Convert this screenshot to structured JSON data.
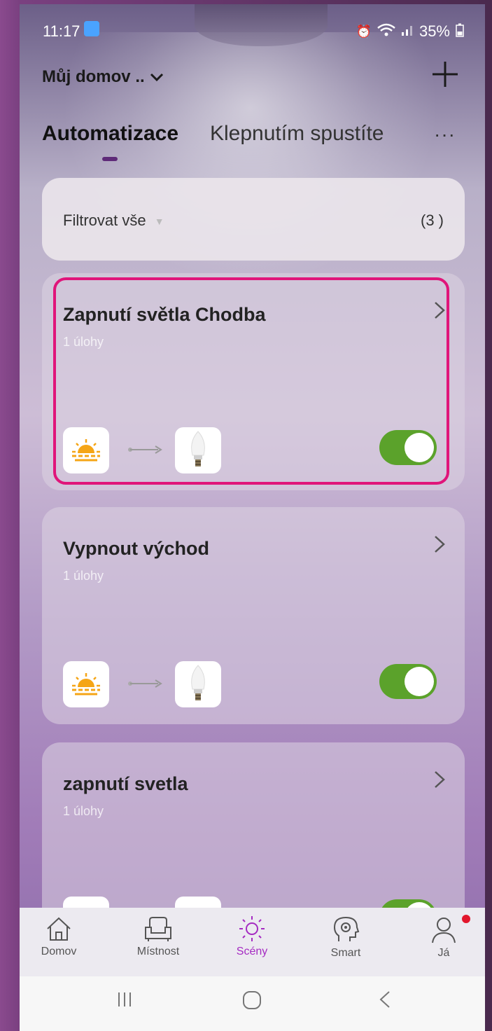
{
  "status_bar": {
    "time": "11:17",
    "battery": "35%"
  },
  "header": {
    "home_name": "Můj domov ..",
    "tabs": [
      {
        "label": "Automatizace",
        "active": true
      },
      {
        "label": "Klepnutím spustíte",
        "active": false
      }
    ],
    "more_label": "···"
  },
  "filter": {
    "label": "Filtrovat vše",
    "count": "(3 )"
  },
  "automations": [
    {
      "title": "Zapnutí světla Chodba",
      "subtitle": "1 úlohy",
      "enabled": true,
      "trigger_icon": "sunrise-icon",
      "action_icon": "bulb-icon"
    },
    {
      "title": "Vypnout východ",
      "subtitle": "1 úlohy",
      "enabled": true,
      "trigger_icon": "sunrise-icon",
      "action_icon": "bulb-icon"
    },
    {
      "title": "zapnutí svetla",
      "subtitle": "1 úlohy",
      "enabled": true,
      "trigger_icon": "sunrise-icon",
      "action_icon": "bulb-icon"
    }
  ],
  "tabbar": {
    "items": [
      {
        "label": "Domov",
        "icon": "home-icon"
      },
      {
        "label": "Místnost",
        "icon": "armchair-icon"
      },
      {
        "label": "Scény",
        "icon": "sun-icon",
        "active": true
      },
      {
        "label": "Smart",
        "icon": "smart-head-icon"
      },
      {
        "label": "Já",
        "icon": "person-icon"
      }
    ]
  },
  "colors": {
    "accent": "#a52bc2",
    "toggle_on": "#5ba22b",
    "highlight": "#e0157a"
  }
}
